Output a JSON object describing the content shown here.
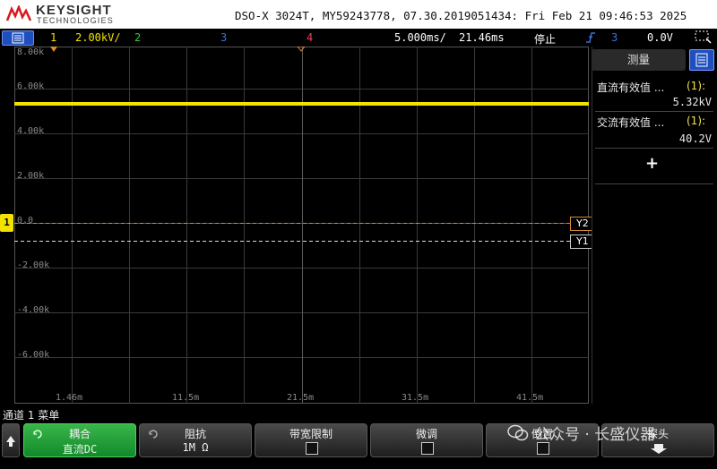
{
  "header": {
    "brand": "KEYSIGHT",
    "brand_sub": "TECHNOLOGIES",
    "model_info": "DSO-X 3024T, MY59243778, 07.30.2019051434: Fri Feb 21 09:46:53 2025"
  },
  "statusbar": {
    "ch1_num": "1",
    "ch1_scale": "2.00kV/",
    "ch2_num": "2",
    "ch3_num": "3",
    "ch4_num": "4",
    "timebase": "5.000ms/",
    "delay": "21.46ms",
    "run_state": "停止",
    "trig_slope_icon": "rising-edge-icon",
    "trig_source": "3",
    "trig_level": "0.0V"
  },
  "graticule": {
    "y_labels": [
      "8.00k",
      "6.00k",
      "4.00k",
      "2.00k",
      "0.0",
      "-2.00k",
      "-4.00k",
      "-6.00k"
    ],
    "x_labels": [
      "1.46m",
      "11.5m",
      "21.5m",
      "31.5m",
      "41.5m"
    ],
    "ch1_marker": "1",
    "cursor_y2_label": "Y2",
    "cursor_y1_label": "Y1",
    "trace_level_kv": 5.32,
    "y2_level_kv": 0.0,
    "y1_level_kv": -0.8
  },
  "panel": {
    "title": "测量",
    "measurements": [
      {
        "name": "直流有效值 ...",
        "ch": "(1):",
        "value": "5.32kV"
      },
      {
        "name": "交流有效值 ...",
        "ch": "(1):",
        "value": "40.2V"
      }
    ],
    "add_label": "+"
  },
  "bottom": {
    "softkey_title": "通道 1 菜单",
    "keys": [
      {
        "label": "耦合",
        "value": "直流DC"
      },
      {
        "label": "阻抗",
        "value": "1M Ω"
      },
      {
        "label": "带宽限制",
        "value": ""
      },
      {
        "label": "微调",
        "value": ""
      },
      {
        "label": "倒置",
        "value": ""
      },
      {
        "label": "探头",
        "value": ""
      }
    ],
    "watermark": "公众号 · 长盛仪器"
  },
  "colors": {
    "ch1": "#f2e200",
    "ch2": "#2ecc40",
    "ch3": "#3b6fe0",
    "ch4": "#e8425a",
    "menu_blue": "#1f4fbf"
  }
}
